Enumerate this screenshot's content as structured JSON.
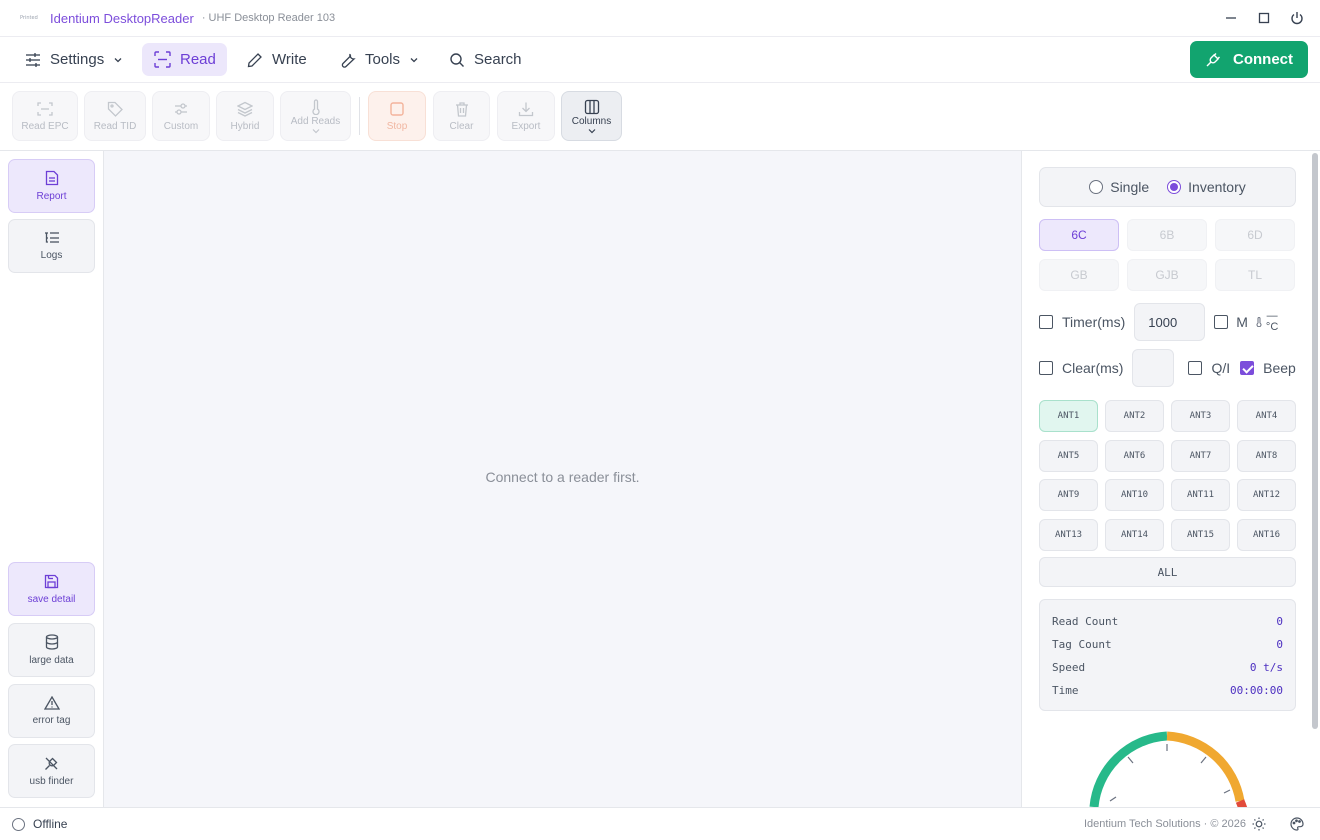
{
  "titlebar": {
    "logo_text": "Printed",
    "app_name": "Identium DesktopReader",
    "subtitle": "· UHF Desktop Reader 103"
  },
  "menu": {
    "items": [
      {
        "label": "Settings",
        "icon": "sliders-icon",
        "has_dropdown": true,
        "active": false
      },
      {
        "label": "Read",
        "icon": "scan-icon",
        "active": true
      },
      {
        "label": "Write",
        "icon": "pen-icon",
        "active": false
      },
      {
        "label": "Tools",
        "icon": "wrench-icon",
        "has_dropdown": true,
        "active": false
      },
      {
        "label": "Search",
        "icon": "search-icon",
        "active": false
      }
    ],
    "connect_label": "Connect",
    "connect_color": "#12a46f"
  },
  "toolbar": {
    "read_epc": "Read EPC",
    "read_tid": "Read TID",
    "custom": "Custom",
    "hybrid": "Hybrid",
    "add_reads": "Add Reads",
    "stop": "Stop",
    "clear": "Clear",
    "export": "Export",
    "columns": "Columns"
  },
  "sidebar": {
    "report": "Report",
    "logs": "Logs",
    "save_detail": "save detail",
    "large_data": "large data",
    "error_tag": "error tag",
    "usb_finder": "usb finder"
  },
  "main": {
    "empty_message": "Connect to a reader first."
  },
  "panel": {
    "mode": {
      "single": "Single",
      "inventory": "Inventory",
      "selected": "Inventory"
    },
    "protocols": [
      "6C",
      "6B",
      "6D",
      "GB",
      "GJB",
      "TL"
    ],
    "protocol_selected": "6C",
    "timer_label": "Timer(ms)",
    "timer_value": "1000",
    "timer_checked": false,
    "m_label": "M",
    "temp_value": "—",
    "temp_unit": "°C",
    "clear_label": "Clear(ms)",
    "clear_value": "",
    "qi_label": "Q/I",
    "beep_label": "Beep",
    "beep_checked": true,
    "antennas": [
      "ANT1",
      "ANT2",
      "ANT3",
      "ANT4",
      "ANT5",
      "ANT6",
      "ANT7",
      "ANT8",
      "ANT9",
      "ANT10",
      "ANT11",
      "ANT12",
      "ANT13",
      "ANT14",
      "ANT15",
      "ANT16"
    ],
    "antenna_selected": "ANT1",
    "all_label": "ALL",
    "stats": {
      "read_count_label": "Read Count",
      "read_count": "0",
      "tag_count_label": "Tag Count",
      "tag_count": "0",
      "speed_label": "Speed",
      "speed": "0 t/s",
      "time_label": "Time",
      "time": "00:00:00"
    },
    "gauge_colors": [
      "#27b98a",
      "#f0a830",
      "#e24b3b"
    ]
  },
  "statusbar": {
    "connection": "Offline",
    "footer": "Identium Tech Solutions · © 2026"
  },
  "colors": {
    "accent": "#7c4ddb",
    "accent_bg": "#ece7fb",
    "success": "#12a46f"
  }
}
